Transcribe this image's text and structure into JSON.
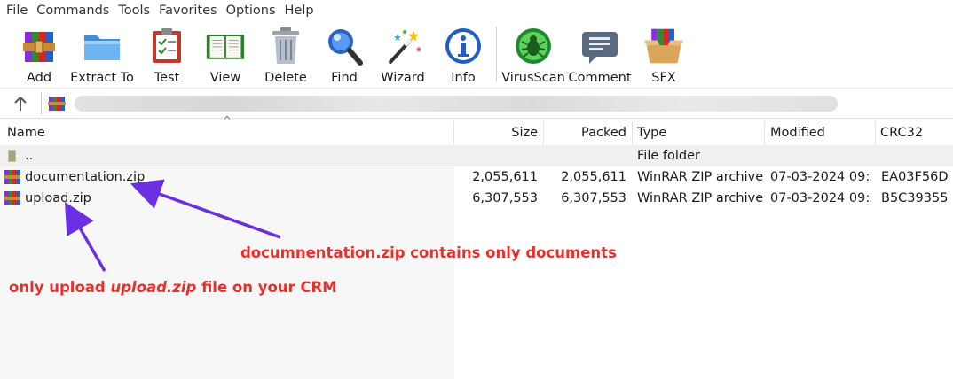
{
  "menu": [
    "File",
    "Commands",
    "Tools",
    "Favorites",
    "Options",
    "Help"
  ],
  "toolbar": {
    "buttons": [
      {
        "label": "Add",
        "icon": "add-archive-icon"
      },
      {
        "label": "Extract To",
        "icon": "extract-folder-icon"
      },
      {
        "label": "Test",
        "icon": "test-clipboard-icon"
      },
      {
        "label": "View",
        "icon": "view-book-icon"
      },
      {
        "label": "Delete",
        "icon": "trash-icon"
      },
      {
        "label": "Find",
        "icon": "magnifier-icon"
      },
      {
        "label": "Wizard",
        "icon": "wizard-wand-icon"
      },
      {
        "label": "Info",
        "icon": "info-icon"
      },
      {
        "label": "VirusScan",
        "icon": "virus-scan-icon"
      },
      {
        "label": "Comment",
        "icon": "comment-icon"
      },
      {
        "label": "SFX",
        "icon": "sfx-box-icon"
      }
    ]
  },
  "address": {
    "path": ""
  },
  "columns": {
    "name": "Name",
    "size": "Size",
    "packed": "Packed",
    "type": "Type",
    "modified": "Modified",
    "crc": "CRC32"
  },
  "rows": [
    {
      "name": "..",
      "size": "",
      "packed": "",
      "type": "File folder",
      "modified": "",
      "crc": ""
    },
    {
      "name": "documentation.zip",
      "size": "2,055,611",
      "packed": "2,055,611",
      "type": "WinRAR ZIP archive",
      "modified": "07-03-2024 09:...",
      "crc": "EA03F56D"
    },
    {
      "name": "upload.zip",
      "size": "6,307,553",
      "packed": "6,307,553",
      "type": "WinRAR ZIP archive",
      "modified": "07-03-2024 09:...",
      "crc": "B5C39355"
    }
  ],
  "annotations": {
    "doc_note": "documnentation.zip contains only documents",
    "upload_note_pre": "only upload ",
    "upload_note_em": "upload.zip",
    "upload_note_post": " file on your CRM"
  },
  "colors": {
    "annotation": "#e8302a",
    "arrow": "#6a2fe0"
  }
}
